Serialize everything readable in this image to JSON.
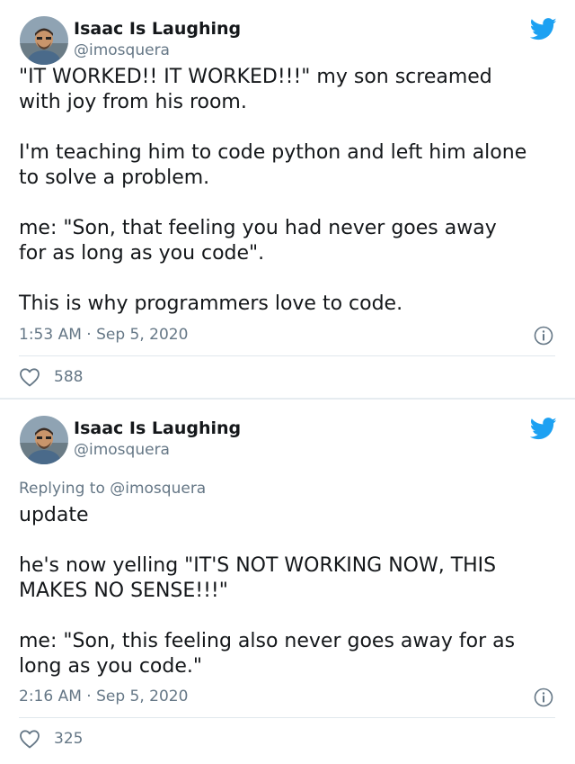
{
  "colors": {
    "twitter_blue": "#1da1f2",
    "secondary_text": "#657786",
    "primary_text": "#14171a",
    "divider": "#e1e8ed"
  },
  "icons": {
    "bird": "twitter-bird-icon",
    "info": "info-icon",
    "like": "heart-icon"
  },
  "tweets": [
    {
      "author": {
        "name": "Isaac Is Laughing",
        "handle": "@imosquera"
      },
      "paragraphs": [
        "\"IT WORKED!! IT WORKED!!!\" my son screamed\nwith joy from his room.",
        "I'm teaching him to code python and left him alone\nto solve a problem.",
        "me: \"Son, that feeling you had never goes away\nfor as long as you code\".",
        "This is why programmers love to code."
      ],
      "timestamp": "1:53 AM · Sep 5, 2020",
      "likes": "588"
    },
    {
      "author": {
        "name": "Isaac Is Laughing",
        "handle": "@imosquera"
      },
      "replying_to": {
        "prefix": "Replying to ",
        "handle": "@imosquera"
      },
      "paragraphs": [
        "update",
        "he's now yelling \"IT'S NOT WORKING NOW, THIS\nMAKES NO SENSE!!!\"",
        "me: \"Son, this feeling also never goes away for as\nlong as you code.\""
      ],
      "timestamp": "2:16 AM · Sep 5, 2020",
      "likes": "325"
    }
  ]
}
